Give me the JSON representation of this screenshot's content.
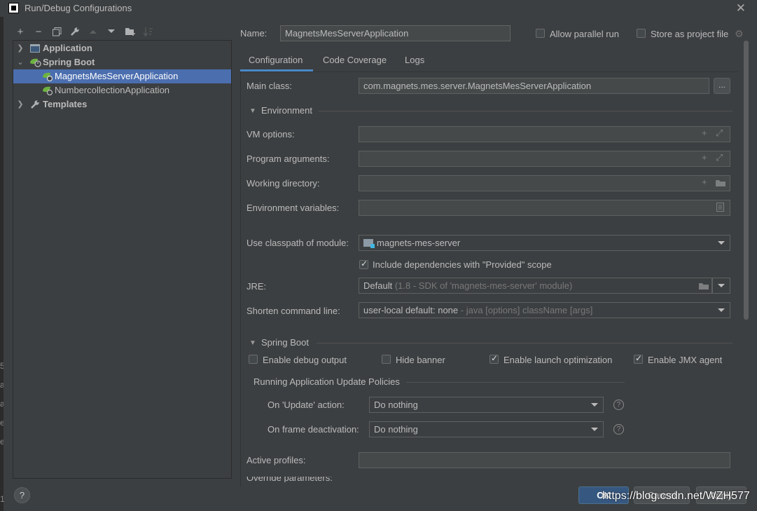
{
  "window": {
    "title": "Run/Debug Configurations"
  },
  "toolbar": {
    "buttons": [
      "add-icon",
      "remove-icon",
      "copy-icon",
      "wrench-icon",
      "move-up-icon",
      "move-down-icon",
      "new-folder-icon",
      "sort-icon"
    ]
  },
  "tree": {
    "items": [
      {
        "label": "Application",
        "level": 0,
        "expanded": false
      },
      {
        "label": "Spring Boot",
        "level": 0,
        "expanded": true
      },
      {
        "label": "MagnetsMesServerApplication",
        "level": 1,
        "selected": true
      },
      {
        "label": "NumbercollectionApplication",
        "level": 1
      },
      {
        "label": "Templates",
        "level": 0,
        "expanded": false
      }
    ]
  },
  "header": {
    "name_label": "Name:",
    "name_value": "MagnetsMesServerApplication",
    "allow_parallel": "Allow parallel run",
    "store_project": "Store as project file"
  },
  "tabs": [
    "Configuration",
    "Code Coverage",
    "Logs"
  ],
  "config": {
    "main_class_label": "Main class:",
    "main_class_value": "com.magnets.mes.server.MagnetsMesServerApplication",
    "browse": "...",
    "environment_section": "Environment",
    "vm_options_label": "VM options:",
    "program_args_label": "Program arguments:",
    "working_dir_label": "Working directory:",
    "env_vars_label": "Environment variables:",
    "classpath_label": "Use classpath of module:",
    "classpath_value": "magnets-mes-server",
    "include_deps": "Include dependencies with \"Provided\" scope",
    "jre_label": "JRE:",
    "jre_value": "Default",
    "jre_hint": "(1.8 - SDK of 'magnets-mes-server' module)",
    "shorten_label": "Shorten command line:",
    "shorten_value": "user-local default: none",
    "shorten_hint": "- java [options] className [args]",
    "spring_section": "Spring Boot",
    "enable_debug": "Enable debug output",
    "hide_banner": "Hide banner",
    "enable_launch": "Enable launch optimization",
    "enable_jmx": "Enable JMX agent",
    "policies_title": "Running Application Update Policies",
    "on_update_label": "On 'Update' action:",
    "on_update_value": "Do nothing",
    "on_frame_label": "On frame deactivation:",
    "on_frame_value": "Do nothing",
    "active_profiles_label": "Active profiles:",
    "override_label": "Override parameters:"
  },
  "checkboxes": {
    "allow_parallel": false,
    "store_project": false,
    "include_deps": true,
    "enable_debug": false,
    "hide_banner": false,
    "enable_launch": true,
    "enable_jmx": true
  },
  "footer": {
    "help": "?",
    "ok": "OK",
    "cancel": "Cancel",
    "apply": "Apply",
    "watermark": "https://blog.csdn.net/WZH577"
  },
  "strip": {
    "glyphs": [
      "5",
      "a",
      "a",
      "e",
      "e"
    ],
    "number": "1"
  },
  "colors": {
    "selection": "#4b6eaf",
    "accent_tab": "#4a88c7",
    "ok_button": "#365880",
    "spring_green": "#6db33f"
  }
}
